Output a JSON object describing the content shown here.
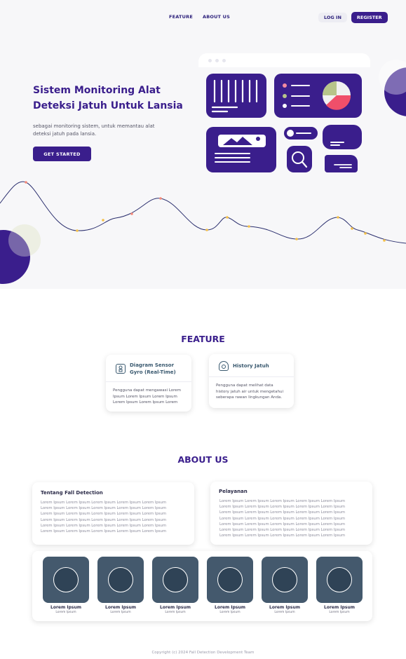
{
  "nav": {
    "links": [
      "FEATURE",
      "ABOUT US"
    ],
    "login_label": "LOG IN",
    "register_label": "REGISTER"
  },
  "hero": {
    "title": "Sistem Monitoring Alat Deteksi Jatuh Untuk Lansia",
    "description": "sebagai monitoring sistem, untuk memantau alat deteksi jatuh pada lansia.",
    "cta_label": "GET STARTED"
  },
  "colors": {
    "primary": "#3a1e8c",
    "wave_line": "#2b2f6e",
    "wave_dots": "#f4c14b",
    "wave_dot_alt": "#f48a7a",
    "team_card": "#44596d"
  },
  "icons": [
    "bar-chart-icon",
    "pie-chart-icon",
    "image-icon",
    "search-icon",
    "toggle-icon",
    "chat-icon",
    "message-icon",
    "sensor-icon",
    "history-icon"
  ],
  "feature": {
    "title": "FEATURE",
    "cards": [
      {
        "title": "Diagram Sensor Gyro (Real-Time)",
        "body": "Pengguna dapat mengawasi Lorem Ipsum Lorem Ipsum Lorem Ipsum Lorem Ipsum Lorem Ipsum Lorem"
      },
      {
        "title": "History Jatuh",
        "body": "Pengguna dapat melihat data history jatuh air untuk mengetahui seberapa rawan lingkungan Anda."
      }
    ]
  },
  "about": {
    "title": "ABOUT US",
    "cards": [
      {
        "title": "Tentang Fall Detection",
        "lines": [
          "Lorem Ipsum Lorem Ipsum Lorem Ipsum Lorem Ipsum Lorem Ipsum",
          "Lorem Ipsum Lorem Ipsum Lorem Ipsum Lorem Ipsum Lorem Ipsum",
          "Lorem Ipsum Lorem Ipsum Lorem Ipsum Lorem Ipsum Lorem Ipsum",
          "Lorem Ipsum Lorem Ipsum Lorem Ipsum Lorem Ipsum Lorem Ipsum",
          "Lorem Ipsum Lorem Ipsum Lorem Ipsum Lorem Ipsum Lorem Ipsum",
          "Lorem Ipsum Lorem Ipsum Lorem Ipsum Lorem Ipsum Lorem Ipsum"
        ]
      },
      {
        "title": "Pelayanan",
        "lines": [
          "Lorem Ipsum Lorem Ipsum Lorem Ipsum Lorem Ipsum Lorem Ipsum",
          "Lorem Ipsum Lorem Ipsum Lorem Ipsum Lorem Ipsum Lorem Ipsum",
          "Lorem Ipsum Lorem Ipsum Lorem Ipsum Lorem Ipsum Lorem Ipsum",
          "Lorem Ipsum Lorem Ipsum Lorem Ipsum Lorem Ipsum Lorem Ipsum",
          "Lorem Ipsum Lorem Ipsum Lorem Ipsum Lorem Ipsum Lorem Ipsum",
          "Lorem Ipsum Lorem Ipsum Lorem Ipsum Lorem Ipsum Lorem Ipsum",
          "Lorem Ipsum Lorem Ipsum Lorem Ipsum Lorem Ipsum Lorem Ipsum"
        ]
      }
    ],
    "team": [
      {
        "name": "Lorem Ipsum",
        "role": "Lorem Ipsum"
      },
      {
        "name": "Lorem Ipsum",
        "role": "Lorem Ipsum"
      },
      {
        "name": "Lorem Ipsum",
        "role": "Lorem Ipsum"
      },
      {
        "name": "Lorem Ipsum",
        "role": "Lorem Ipsum"
      },
      {
        "name": "Lorem Ipsum",
        "role": "Lorem Ipsum"
      },
      {
        "name": "Lorem Ipsum",
        "role": "Lorem Ipsum"
      }
    ]
  },
  "footer": {
    "copyright": "Copyright (c) 2024 Fall Detection Development Team"
  }
}
